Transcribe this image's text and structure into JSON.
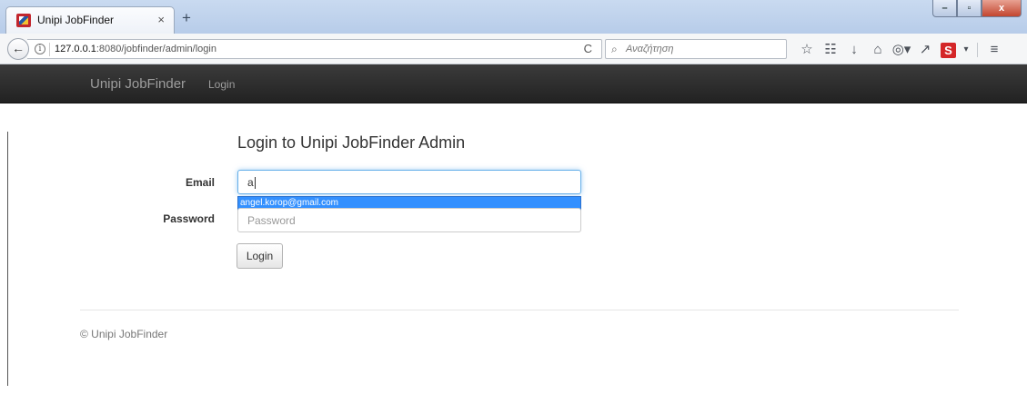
{
  "browser": {
    "tab": {
      "title": "Unipi JobFinder",
      "close": "×",
      "new_tab": "+"
    },
    "window_buttons": {
      "minimize": "–",
      "maximize": "▫",
      "close": "x"
    },
    "url": {
      "host": "127.0.0.1",
      "rest": ":8080/jobfinder/admin/login"
    },
    "search_placeholder": "Αναζήτηση",
    "toolbar_icons": [
      "star-icon",
      "reading-list-icon",
      "download-icon",
      "home-icon",
      "addon-icon",
      "pin-icon",
      "s-extension-icon",
      "dropdown-icon",
      "menu-icon"
    ]
  },
  "site": {
    "brand": "Unipi JobFinder",
    "nav": {
      "login": "Login"
    },
    "title": "Login to Unipi JobFinder Admin",
    "form": {
      "email_label": "Email",
      "email_value": "a",
      "autocomplete_suggestion": "angel.korop@gmail.com",
      "password_label": "Password",
      "password_placeholder": "Password",
      "submit_label": "Login"
    },
    "footer": "© Unipi JobFinder"
  },
  "colors": {
    "navbar_bg": "#222222",
    "navbar_text": "#9d9d9d",
    "autocomplete_highlight": "#3390ff",
    "focus_border": "#66afe9"
  }
}
